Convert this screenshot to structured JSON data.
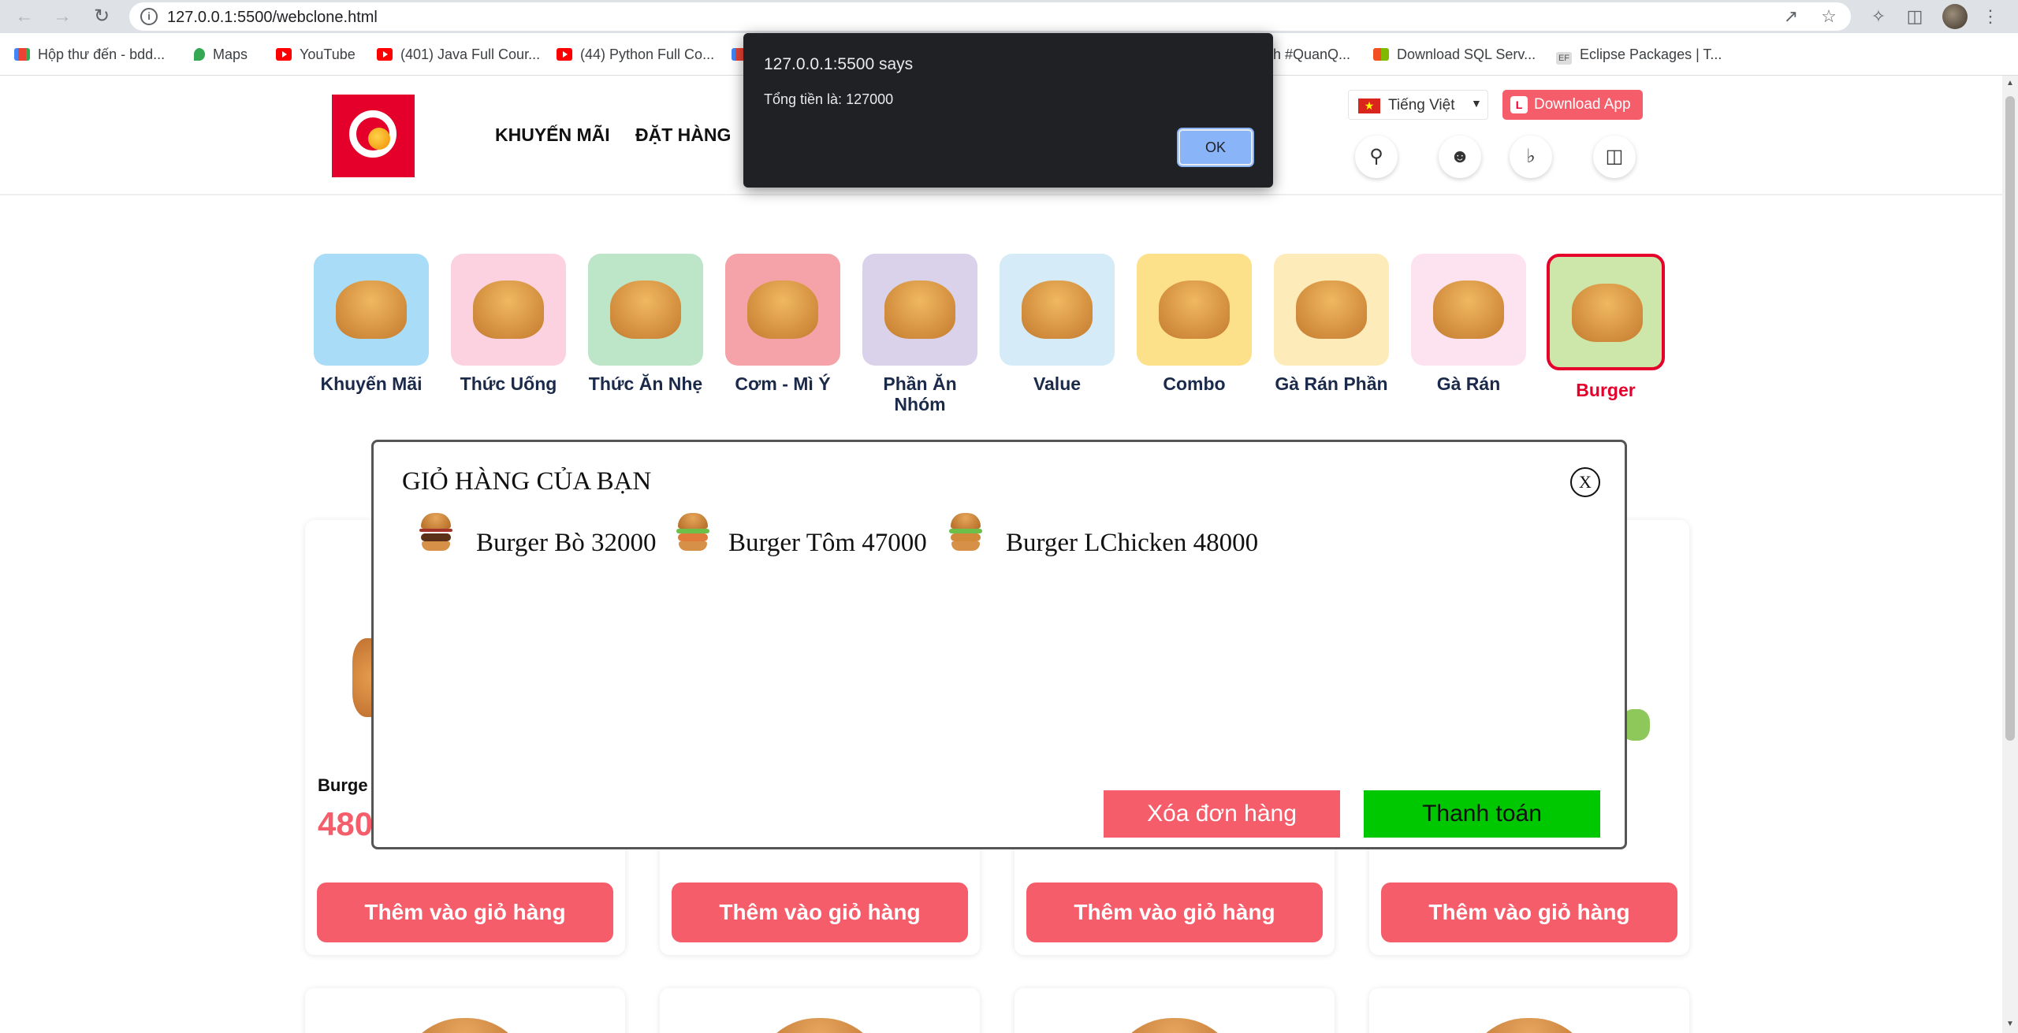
{
  "browser": {
    "url": "127.0.0.1:5500/webclone.html",
    "bookmarks": [
      {
        "label": "Hộp thư đến - bdd...",
        "icon": "gmail-icon"
      },
      {
        "label": "Maps",
        "icon": "maps-icon"
      },
      {
        "label": "YouTube",
        "icon": "youtube-icon"
      },
      {
        "label": "(401) Java Full Cour...",
        "icon": "youtube-icon"
      },
      {
        "label": "(44) Python Full Co...",
        "icon": "youtube-icon"
      },
      {
        "label": "ch #QuanQ...",
        "icon": ""
      },
      {
        "label": "Download SQL Serv...",
        "icon": "microsoft-icon"
      },
      {
        "label": "Eclipse Packages | T...",
        "icon": "eclipse-icon"
      }
    ]
  },
  "alert": {
    "heading": "127.0.0.1:5500 says",
    "message": "Tổng tiền là: 127000",
    "ok_label": "OK"
  },
  "header": {
    "menu": [
      "KHUYẾN MÃI",
      "ĐẶT HÀNG"
    ],
    "language": "Tiếng Việt",
    "download_app": "Download App",
    "icons": [
      "location-icon",
      "user-icon",
      "bell-icon",
      "shopping-bag-icon"
    ]
  },
  "categories": [
    {
      "label": "Khuyến Mãi",
      "bg": "#a9dcf6"
    },
    {
      "label": "Thức Uống",
      "bg": "#fcd2e1"
    },
    {
      "label": "Thức Ăn Nhẹ",
      "bg": "#bde5c8"
    },
    {
      "label": "Cơm - Mì Ý",
      "bg": "#f5a3a8"
    },
    {
      "label": "Phần Ăn Nhóm",
      "bg": "#d9d2ea"
    },
    {
      "label": "Value",
      "bg": "#d5ebf7"
    },
    {
      "label": "Combo",
      "bg": "#fde08a"
    },
    {
      "label": "Gà Rán Phần",
      "bg": "#fdebb9"
    },
    {
      "label": "Gà Rán",
      "bg": "#fde3ef"
    },
    {
      "label": "Burger",
      "bg": "#cde6a9",
      "active": true
    }
  ],
  "cards": [
    {
      "name": "Burge",
      "price": "480",
      "button": "Thêm vào giỏ hàng"
    },
    {
      "button": "Thêm vào giỏ hàng"
    },
    {
      "button": "Thêm vào giỏ hàng"
    },
    {
      "button": "Thêm vào giỏ hàng"
    }
  ],
  "cart": {
    "title": "GIỎ HÀNG CỦA BẠN",
    "close_label": "X",
    "items": [
      {
        "label": "Burger Bò  32000"
      },
      {
        "label": "Burger Tôm  47000"
      },
      {
        "label": "Burger LChicken  48000"
      }
    ],
    "clear_label": "Xóa đơn hàng",
    "pay_label": "Thanh toán",
    "colors": {
      "clear": "#f65d6a",
      "pay": "#00c800"
    }
  },
  "colors": {
    "brand": "#e4002b",
    "accent": "#f65d6a"
  }
}
